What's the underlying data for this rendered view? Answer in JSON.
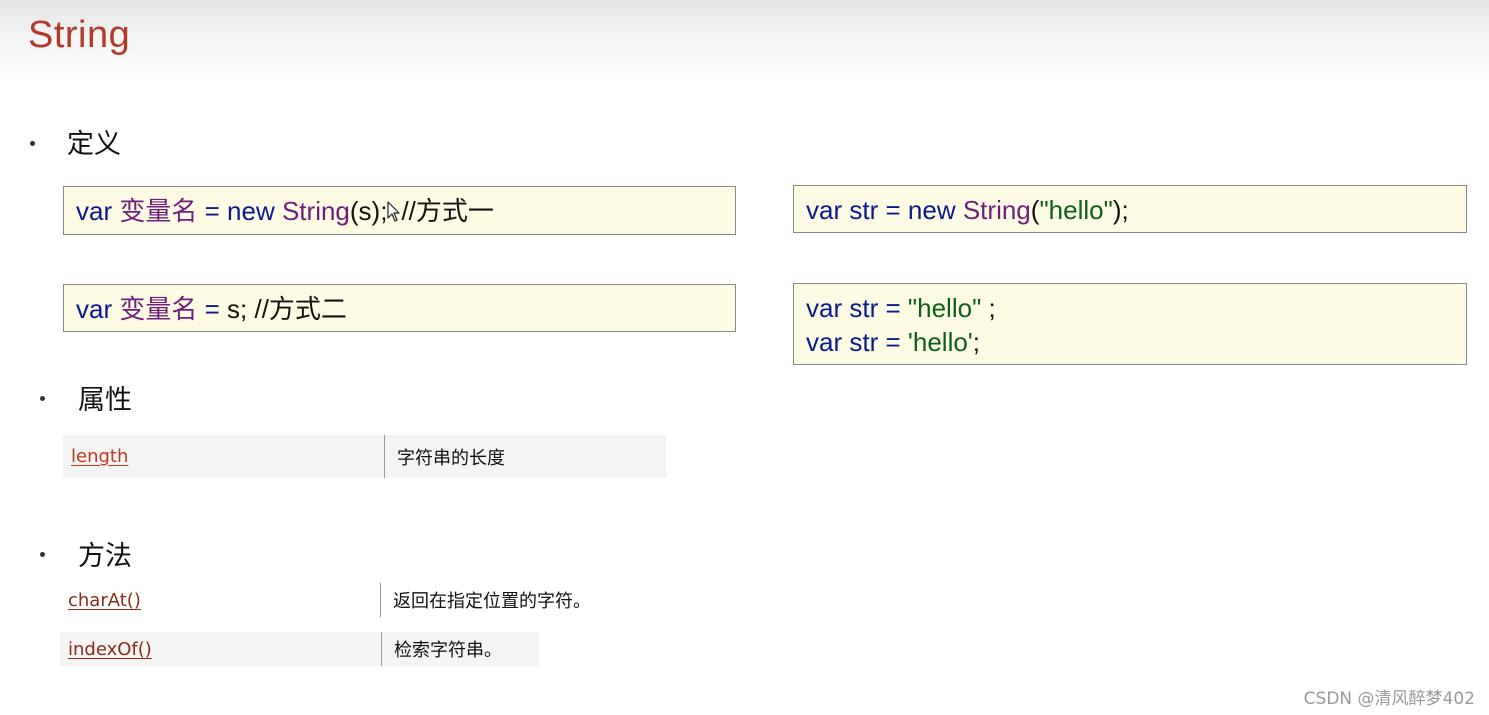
{
  "slide": {
    "title": "String"
  },
  "sections": {
    "definition": {
      "heading": "定义"
    },
    "properties": {
      "heading": "属性"
    },
    "methods": {
      "heading": "方法"
    }
  },
  "code": {
    "way1": {
      "var": "var",
      "name": "变量名",
      "eq": "=",
      "new": "new",
      "cls": "String",
      "args": "(s);",
      "comment": "//方式一"
    },
    "way2": {
      "var": "var",
      "name": "变量名",
      "eq": "=",
      "rest": "s; //方式二"
    },
    "example1": {
      "var": "var",
      "ident": "str",
      "eq": "=",
      "new": "new",
      "cls": "String",
      "open": "(",
      "str": "\"hello\"",
      "close": ");"
    },
    "example2": {
      "line1": {
        "var": "var",
        "ident": "str",
        "eq": "=",
        "str": "\"hello\"",
        "end": ";"
      },
      "line2": {
        "var": "var",
        "ident": "str",
        "eq": "=",
        "str": "'hello'",
        "end": ";"
      }
    }
  },
  "properties_table": [
    {
      "name": "length",
      "desc": "字符串的长度"
    }
  ],
  "methods_table": [
    {
      "name": "charAt()",
      "desc": "返回在指定位置的字符。"
    },
    {
      "name": "indexOf()",
      "desc": "检索字符串。"
    }
  ],
  "icons": {
    "cursor": "mouse-pointer-icon",
    "bullet": "bullet-dot"
  },
  "colors": {
    "title": "#b13a2a",
    "keyword": "#0a1a8c",
    "class_name": "#6e1f7c",
    "string_literal": "#0e5f18",
    "code_background": "#fdfbe3",
    "link_red": "#c0391f"
  },
  "watermark": "CSDN @清风醉梦402"
}
